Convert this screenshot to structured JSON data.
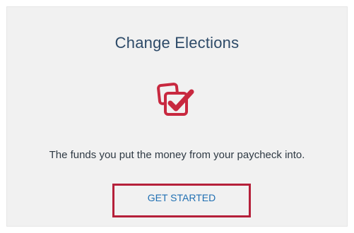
{
  "card": {
    "title": "Change Elections",
    "icon": "checkbox-copy-icon",
    "description": "The funds you put the money from your paycheck into.",
    "cta_label": "GET STARTED"
  },
  "colors": {
    "card_background": "#f1f1f1",
    "title": "#2d4a68",
    "icon": "#c8283f",
    "description": "#2f3a44",
    "cta_text": "#1f6fb2",
    "highlight_border": "#b5203a"
  }
}
